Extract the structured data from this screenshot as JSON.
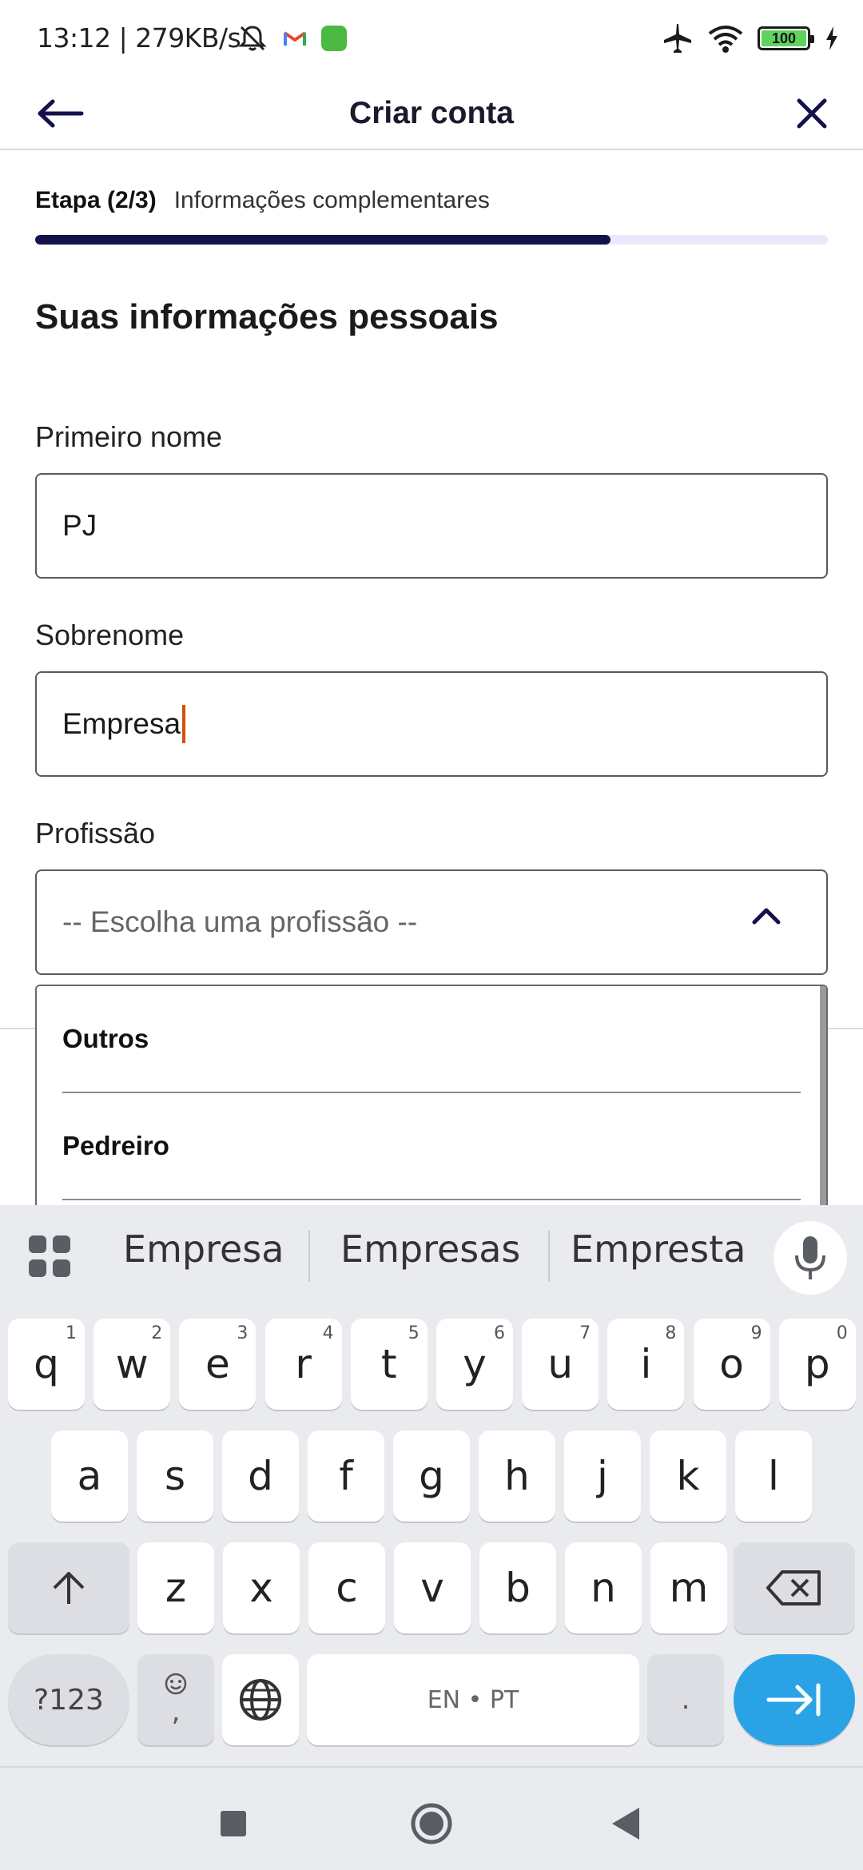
{
  "status_bar": {
    "time": "13:12 | 279KB/s",
    "battery": "100"
  },
  "header": {
    "title": "Criar conta"
  },
  "progress": {
    "step_label": "Etapa (2/3)",
    "step_description": "Informações complementares",
    "fraction": 0.7258
  },
  "section_title": "Suas informações pessoais",
  "form": {
    "first_name": {
      "label": "Primeiro nome",
      "value": "PJ"
    },
    "last_name": {
      "label": "Sobrenome",
      "value": "Empresa"
    },
    "profession": {
      "label": "Profissão",
      "placeholder": "-- Escolha uma profissão --"
    }
  },
  "dropdown": {
    "options": [
      "Outros",
      "Pedreiro"
    ]
  },
  "keyboard": {
    "suggestions": [
      "Empresa",
      "Empresas",
      "Empresta"
    ],
    "row1": [
      {
        "key": "q",
        "hint": "1"
      },
      {
        "key": "w",
        "hint": "2"
      },
      {
        "key": "e",
        "hint": "3"
      },
      {
        "key": "r",
        "hint": "4"
      },
      {
        "key": "t",
        "hint": "5"
      },
      {
        "key": "y",
        "hint": "6"
      },
      {
        "key": "u",
        "hint": "7"
      },
      {
        "key": "i",
        "hint": "8"
      },
      {
        "key": "o",
        "hint": "9"
      },
      {
        "key": "p",
        "hint": "0"
      }
    ],
    "row2": [
      "a",
      "s",
      "d",
      "f",
      "g",
      "h",
      "j",
      "k",
      "l"
    ],
    "row3": [
      "z",
      "x",
      "c",
      "v",
      "b",
      "n",
      "m"
    ],
    "symbols_label": "?123",
    "comma_label": ",",
    "space_label": "EN • PT",
    "period_label": "."
  },
  "colors": {
    "accent": "#14124a",
    "track": "#e8e9fb",
    "caret": "#d4500a",
    "enter_key": "#2aa3e6"
  }
}
